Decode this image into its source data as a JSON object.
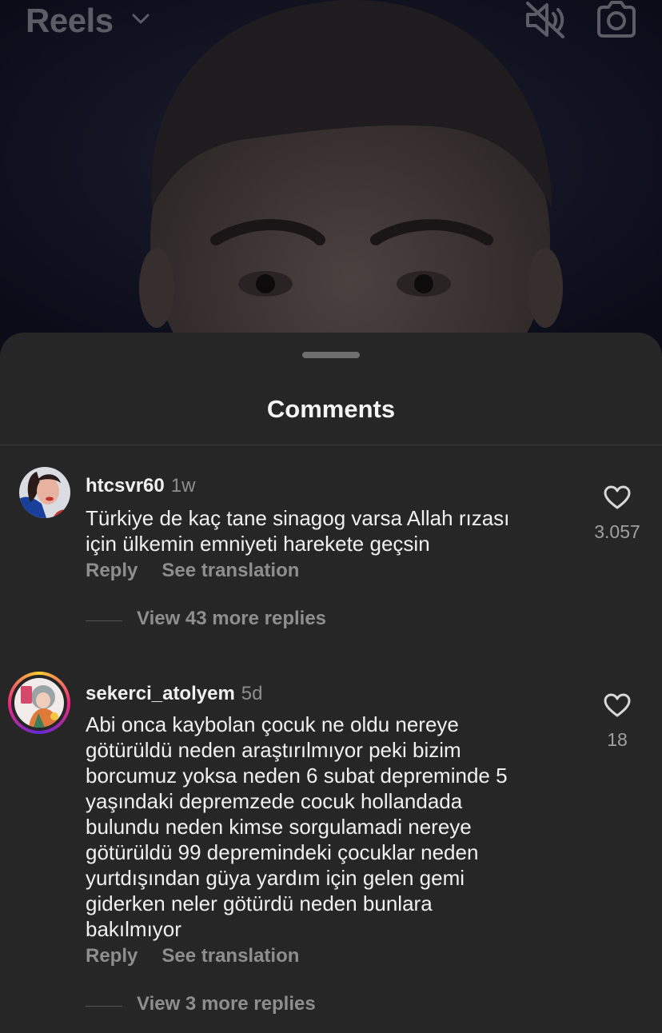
{
  "topbar": {
    "title": "Reels",
    "icons": [
      "chevron-down-icon",
      "speaker-muted-icon",
      "camera-icon"
    ]
  },
  "sheet": {
    "title": "Comments"
  },
  "comments": [
    {
      "username": "htcsvr60",
      "time": "1w",
      "text": "Türkiye de kaç tane sinagog varsa Allah rızası\niçin ülkemin emniyeti harekete geçsin",
      "likes": "3.057",
      "reply_label": "Reply",
      "translate_label": "See translation",
      "view_replies": "View 43 more replies"
    },
    {
      "username": "sekerci_atolyem",
      "time": "5d",
      "text": "Abi onca kaybolan çocuk ne oldu nereye\ngötürüldü neden araştırılmıyor peki bizim\nborcumuz yoksa neden 6 subat depreminde 5\nyaşındaki depremzede cocuk hollandada\nbulundu neden kimse sorgulamadi nereye\ngötürüldü 99 depremindeki çocuklar neden\nyurtdışından güya yardım için gelen gemi\ngiderken neler götürdü neden bunlara\nbakılmıyor",
      "likes": "18",
      "reply_label": "Reply",
      "translate_label": "See translation",
      "view_replies": "View 3 more replies"
    }
  ],
  "colors": {
    "sheet_bg": "#262626",
    "primary_text": "#f0f0f0",
    "secondary_text": "#8e8e8e",
    "story_ring": [
      "#f9ce34",
      "#ee2a7b",
      "#6228d7"
    ]
  }
}
